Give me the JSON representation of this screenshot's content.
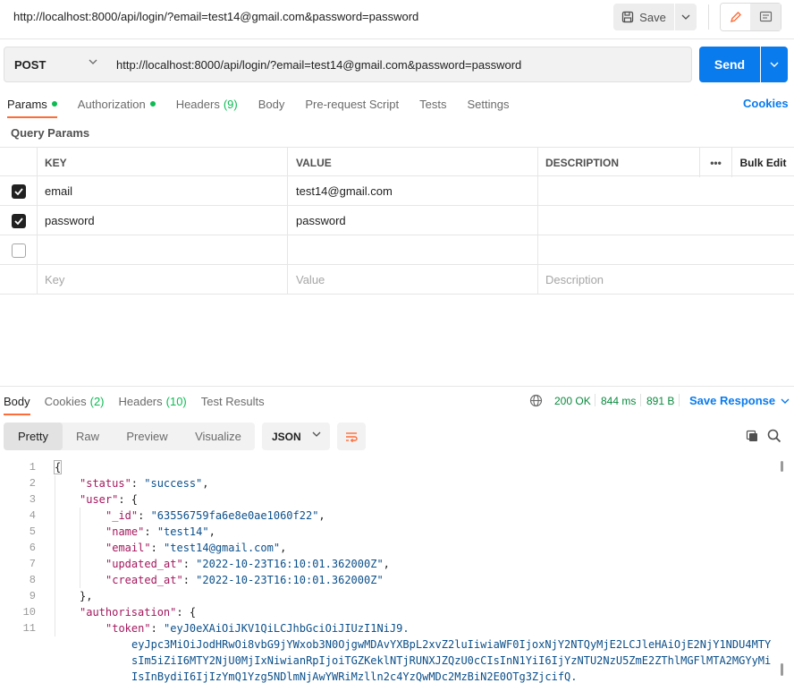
{
  "titlebar": {
    "url": "http://localhost:8000/api/login/?email=test14@gmail.com&password=password",
    "save_label": "Save"
  },
  "request": {
    "method": "POST",
    "url": "http://localhost:8000/api/login/?email=test14@gmail.com&password=password",
    "send_label": "Send"
  },
  "request_tabs": {
    "params": "Params",
    "authorization": "Authorization",
    "headers": "Headers",
    "headers_count": "(9)",
    "body": "Body",
    "prerequest": "Pre-request Script",
    "tests": "Tests",
    "settings": "Settings",
    "cookies": "Cookies"
  },
  "query_params": {
    "title": "Query Params",
    "headers": {
      "key": "KEY",
      "value": "VALUE",
      "description": "DESCRIPTION",
      "more": "•••",
      "bulk_edit": "Bulk Edit"
    },
    "rows": [
      {
        "checked": true,
        "key": "email",
        "value": "test14@gmail.com",
        "description": ""
      },
      {
        "checked": true,
        "key": "password",
        "value": "password",
        "description": ""
      },
      {
        "checked": false,
        "key": "",
        "value": "",
        "description": ""
      }
    ],
    "placeholders": {
      "key": "Key",
      "value": "Value",
      "description": "Description"
    }
  },
  "response_tabs": {
    "body": "Body",
    "cookies": "Cookies",
    "cookies_count": "(2)",
    "headers": "Headers",
    "headers_count": "(10)",
    "test_results": "Test Results"
  },
  "response_status": {
    "status": "200 OK",
    "time": "844 ms",
    "size": "891 B",
    "save_response": "Save Response"
  },
  "view_modes": {
    "pretty": "Pretty",
    "raw": "Raw",
    "preview": "Preview",
    "visualize": "Visualize",
    "format": "JSON"
  },
  "code": {
    "line_numbers": [
      "1",
      "2",
      "3",
      "4",
      "5",
      "6",
      "7",
      "8",
      "9",
      "10",
      "11",
      "",
      ""
    ],
    "l1": "{",
    "l2_key": "\"status\"",
    "l2_val": "\"success\"",
    "l3_key": "\"user\"",
    "l4_key": "\"_id\"",
    "l4_val": "\"63556759fa6e8e0ae1060f22\"",
    "l5_key": "\"name\"",
    "l5_val": "\"test14\"",
    "l6_key": "\"email\"",
    "l6_val": "\"test14@gmail.com\"",
    "l7_key": "\"updated_at\"",
    "l7_val": "\"2022-10-23T16:10:01.362000Z\"",
    "l8_key": "\"created_at\"",
    "l8_val": "\"2022-10-23T16:10:01.362000Z\"",
    "l9": "},",
    "l10_key": "\"authorisation\"",
    "l11_key": "\"token\"",
    "l11_val": "\"eyJ0eXAiOiJKV1QiLCJhbGciOiJIUzI1NiJ9.",
    "l11_cont1": "eyJpc3MiOiJodHRwOi8vbG9jYWxob3N0OjgwMDAvYXBpL2xvZ2luIiwiaWF0IjoxNjY2NTQyMjE2LCJleHAiOjE2NjY1NDU4MTY",
    "l11_cont2": "sIm5iZiI6MTY2NjU0MjIxNiwianRpIjoiTGZKeklNTjRUNXJZQzU0cCIsInN1YiI6IjYzNTU2NzU5ZmE2ZThlMGFlMTA2MGYyMi",
    "l11_cont3": "IsInBydiI6IjIzYmQ1Yzg5NDlmNjAwYWRiMzlln2c4YzQwMDc2MzBiN2E0OTg3ZjcifQ."
  },
  "colors": {
    "accent": "#ff6c37",
    "send": "#097bed",
    "success": "#0cbb52",
    "json_key": "#a3185d",
    "json_string": "#0b4f8a"
  }
}
